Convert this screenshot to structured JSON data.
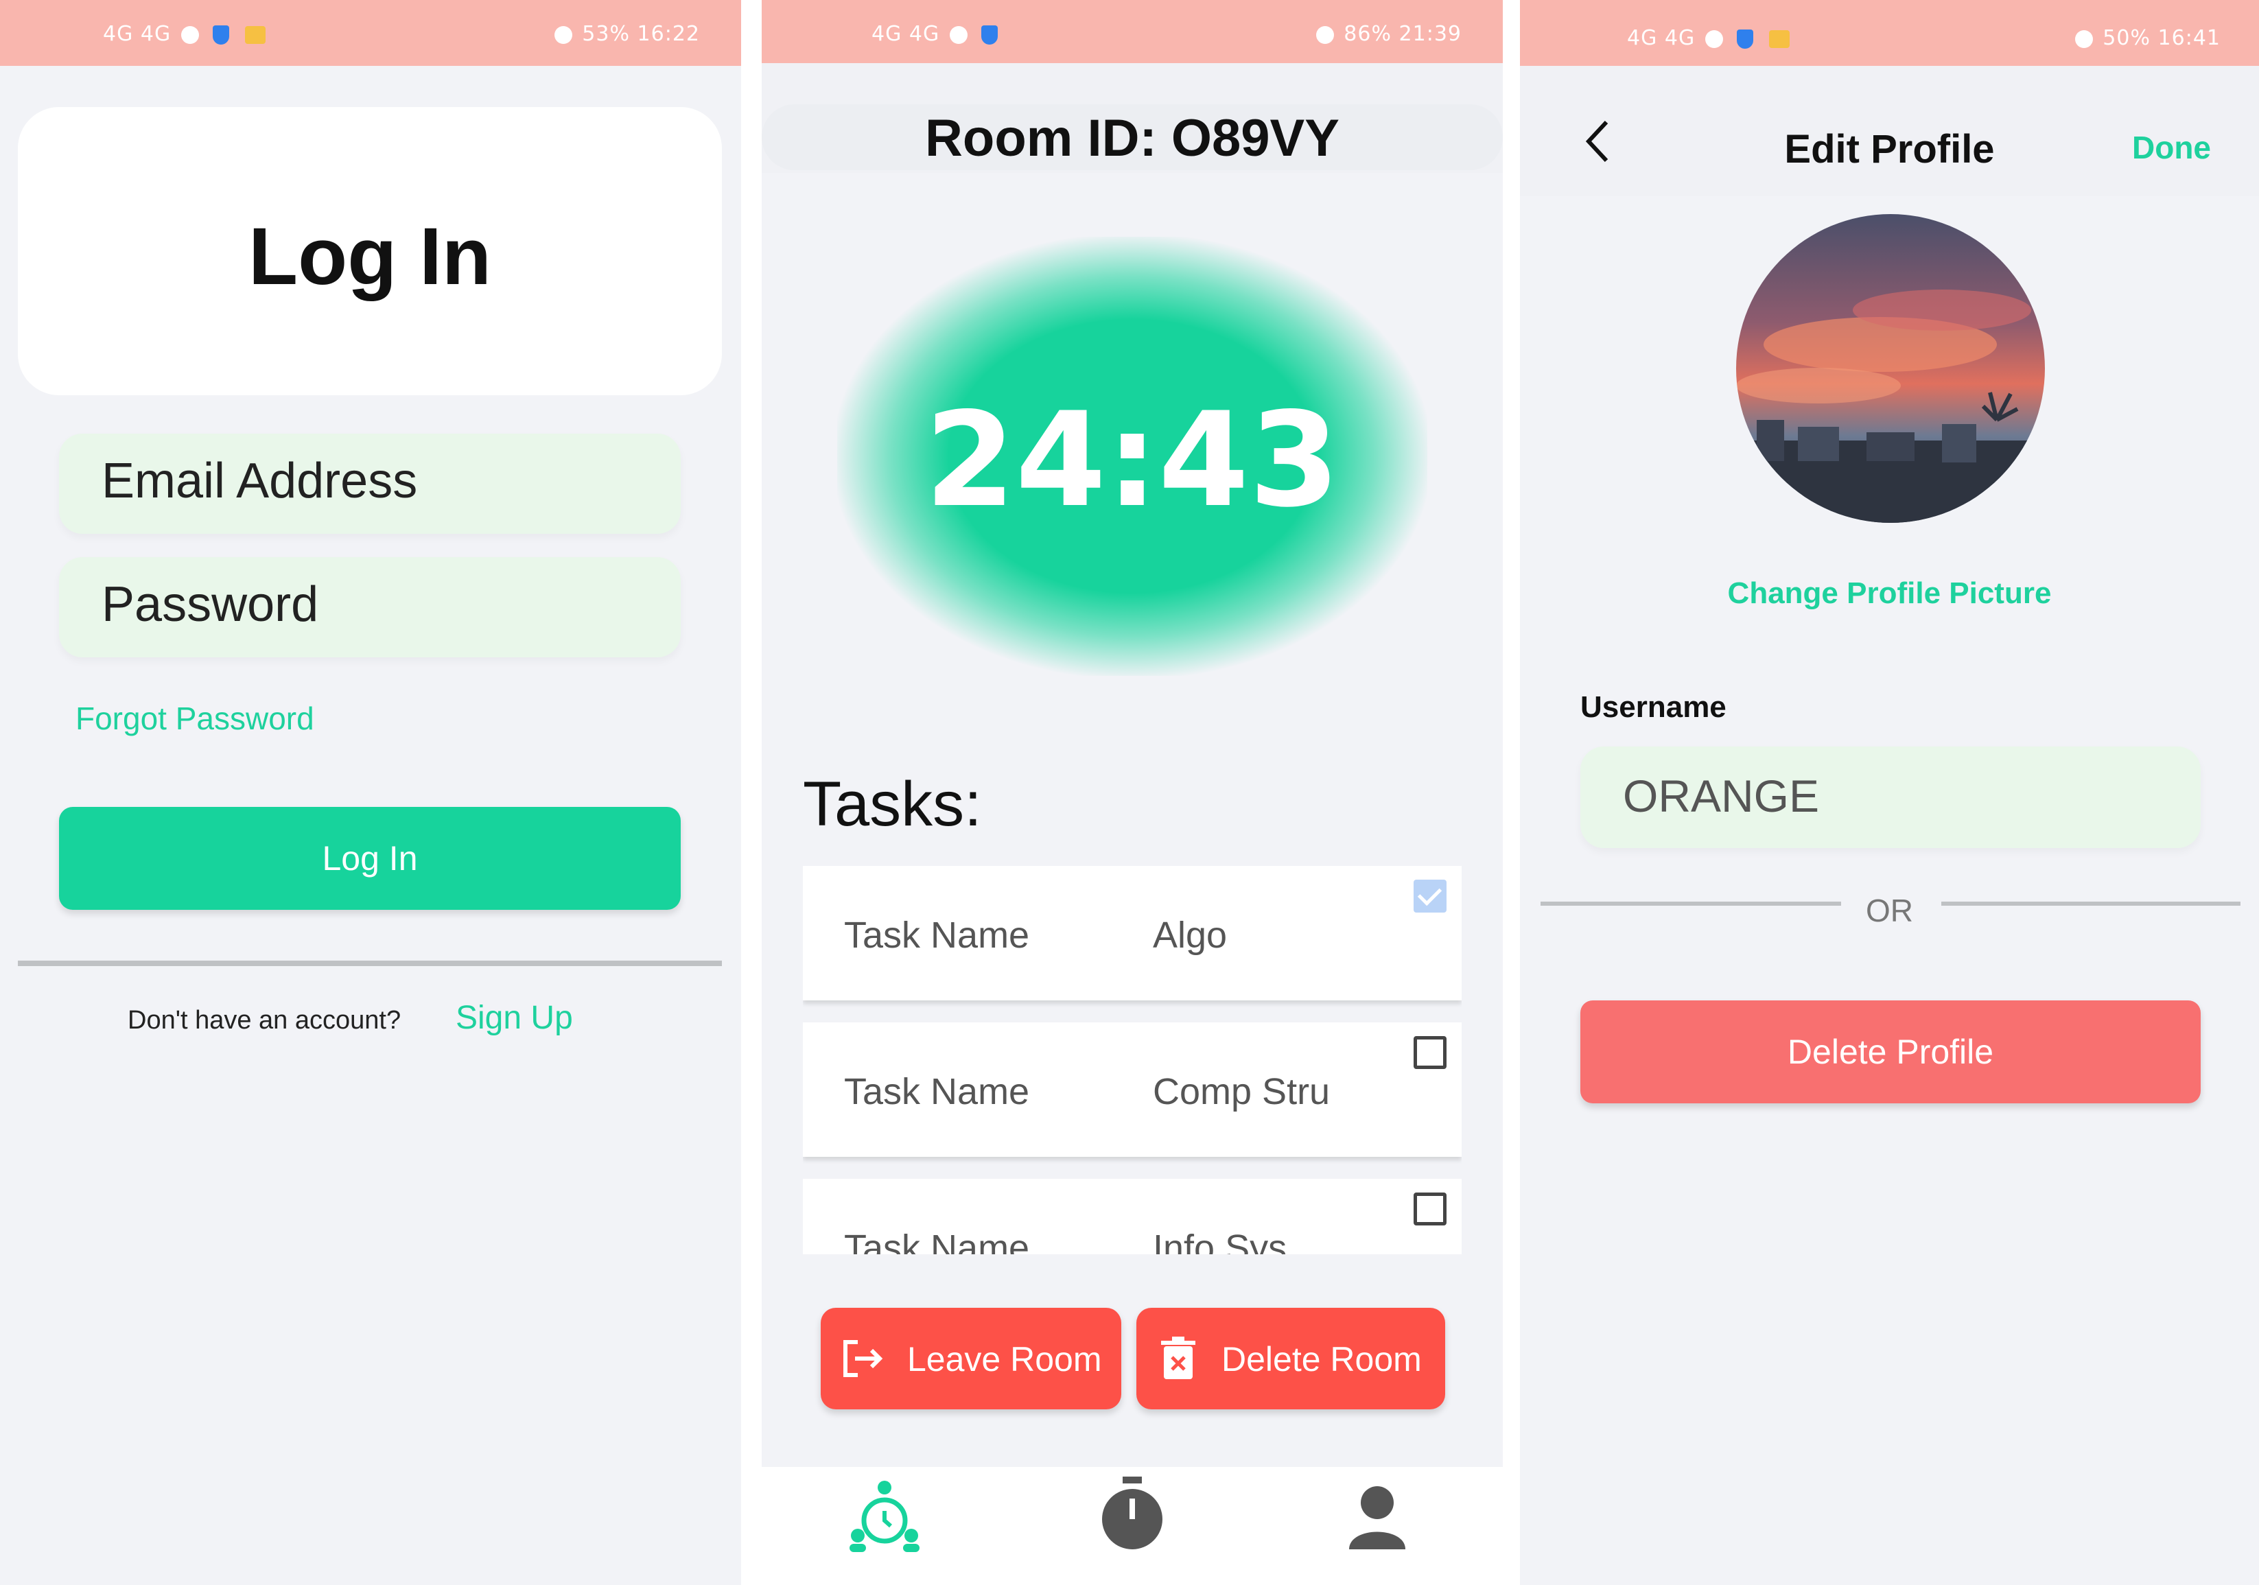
{
  "login_screen": {
    "status_bar": {
      "left": "4G 4G",
      "battery": "53%",
      "time": "16:22"
    },
    "title": "Log In",
    "email_placeholder": "Email Address",
    "password_placeholder": "Password",
    "forgot_password": "Forgot Password",
    "login_button": "Log In",
    "no_account_text": "Don't have an account?",
    "sign_up": "Sign Up",
    "accent_color": "#17d39c"
  },
  "room_screen": {
    "status_bar": {
      "left": "4G 4G",
      "battery": "86%",
      "time": "21:39"
    },
    "room_id": "Room ID: O89VY",
    "timer": "24:43",
    "tasks_title": "Tasks:",
    "tasks": [
      {
        "label": "Task Name",
        "value": "Algo",
        "checked": true
      },
      {
        "label": "Task Name",
        "value": "Comp Stru",
        "checked": false
      },
      {
        "label": "Task Name",
        "value": "Info Sys",
        "checked": false
      }
    ],
    "leave_room": "Leave Room",
    "delete_room": "Delete Room",
    "nav_icons": [
      "group-timer-icon",
      "stopwatch-icon",
      "profile-icon"
    ],
    "danger_color": "#fd5148"
  },
  "profile_screen": {
    "status_bar": {
      "left": "4G 4G",
      "battery": "50%",
      "time": "16:41"
    },
    "title": "Edit Profile",
    "done": "Done",
    "change_picture": "Change Profile Picture",
    "username_label": "Username",
    "username_value": "ORANGE",
    "or_text": "OR",
    "delete_profile": "Delete Profile"
  }
}
